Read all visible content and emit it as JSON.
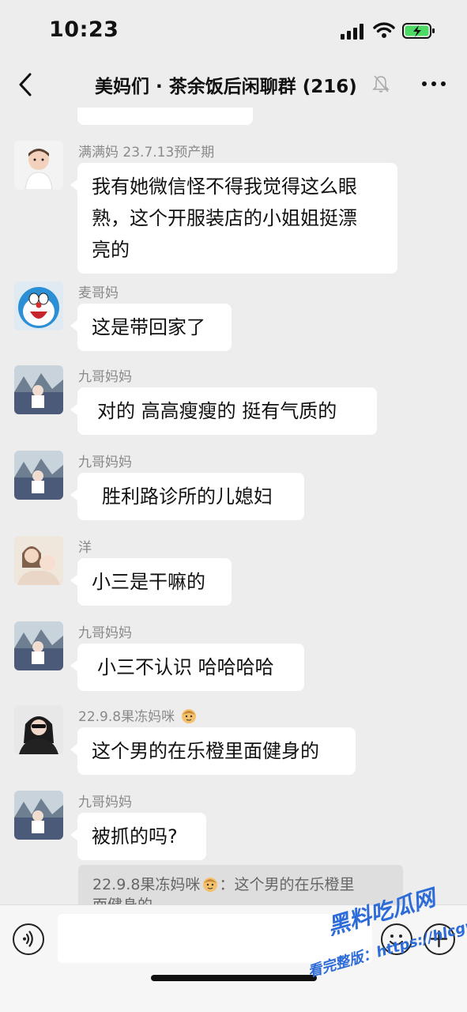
{
  "status_bar": {
    "time": "10:23"
  },
  "header": {
    "title": "美妈们 · 茶余饭后闲聊群 (216)"
  },
  "messages": [
    {
      "sender": "满满妈 23.7.13预产期",
      "text_lines": [
        "我有她微信怪不得我觉得这么眼",
        "熟，这个开服装店的小姐姐挺漂",
        "亮的"
      ]
    },
    {
      "sender": "麦哥妈",
      "text": "这是带回家了"
    },
    {
      "sender": "九哥妈妈",
      "text": "对的 高高瘦瘦的 挺有气质的"
    },
    {
      "sender": "九哥妈妈",
      "text": "胜利路诊所的儿媳妇"
    },
    {
      "sender": "洋",
      "text": "小三是干嘛的"
    },
    {
      "sender": "九哥妈妈",
      "text": "小三不认识 哈哈哈哈"
    },
    {
      "sender": "22.9.8果冻妈咪",
      "text": "这个男的在乐橙里面健身的"
    },
    {
      "sender": "九哥妈妈",
      "text": "被抓的吗?"
    }
  ],
  "quote": {
    "author": "22.9.8果冻妈咪",
    "text_line1": "：这个男的在乐橙里",
    "text_line2": "面健身的"
  },
  "watermark": {
    "line1": "黑料吃瓜网",
    "line2": "看完整版：https://hlcgw.co"
  },
  "icons": [
    "back-icon",
    "mute-icon",
    "more-icon",
    "voice-icon",
    "emoji-icon",
    "plus-icon"
  ],
  "colors": {
    "background": "#ededed",
    "bubble": "#ffffff",
    "sender": "#8a8a8a"
  }
}
